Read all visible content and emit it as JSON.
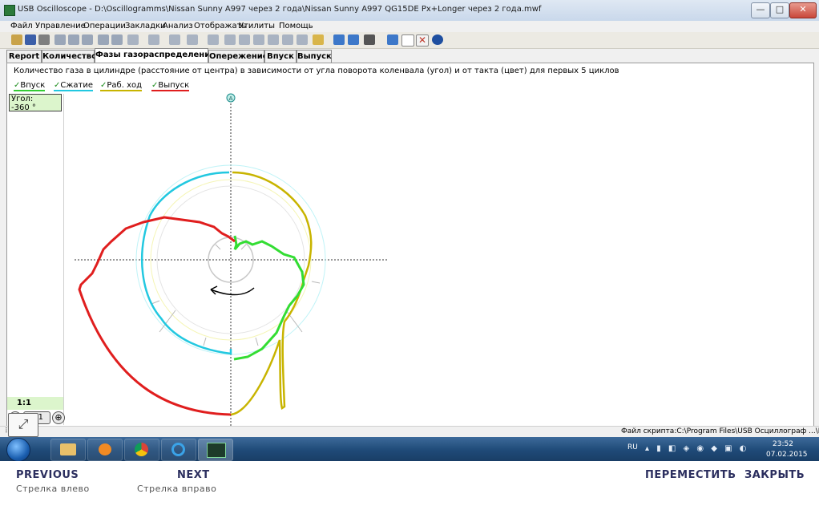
{
  "window": {
    "title": "USB Oscilloscope - D:\\Oscillogramms\\Nissan Sunny A997 через 2 года\\Nissan Sunny A997 QG15DE Px+Longer через 2 года.mwf",
    "minimize": "—",
    "maximize": "□",
    "close": "✕"
  },
  "menu": [
    "Файл",
    "Управление",
    "Операции",
    "Закладки",
    "Анализ",
    "Отображать",
    "Утилиты",
    "Помощь"
  ],
  "tabs": [
    "Report",
    "Количество",
    "Фазы газораспределения",
    "Опережение",
    "Впуск",
    "Выпуск"
  ],
  "active_tab": "Фазы газораспределения",
  "chart": {
    "description": "Количество газа в цилиндре (расстояние от центра) в зависимости от угла поворота коленвала (угол) и от такта (цвет) для первых 5 циклов",
    "legend": [
      {
        "label": "Впуск",
        "color": "#33cc33"
      },
      {
        "label": "Сжатие",
        "color": "#22c8e0"
      },
      {
        "label": "Раб. ход",
        "color": "#c8b400"
      },
      {
        "label": "Выпуск",
        "color": "#e01e1e"
      }
    ],
    "top_marker": "A"
  },
  "left_panel": {
    "angle_label": "Угол:",
    "angle_value": "-360 °",
    "ratio": "1:1",
    "zoom_out": "⊖",
    "zoom_reset": "1:1",
    "zoom_in": "⊕"
  },
  "statusbar": {
    "script_file": "Файл скрипта:C:\\Program Files\\USB Осциллограф ...\\Px.asc"
  },
  "taskbar": {
    "lang": "RU",
    "time": "23:52",
    "date": "07.02.2015"
  },
  "nav": {
    "previous": "PREVIOUS",
    "previous_hint": "Стрелка влево",
    "next": "NEXT",
    "next_hint": "Стрелка вправо",
    "move": "ПЕРЕМЕСТИТЬ",
    "close": "ЗАКРЫТЬ"
  }
}
